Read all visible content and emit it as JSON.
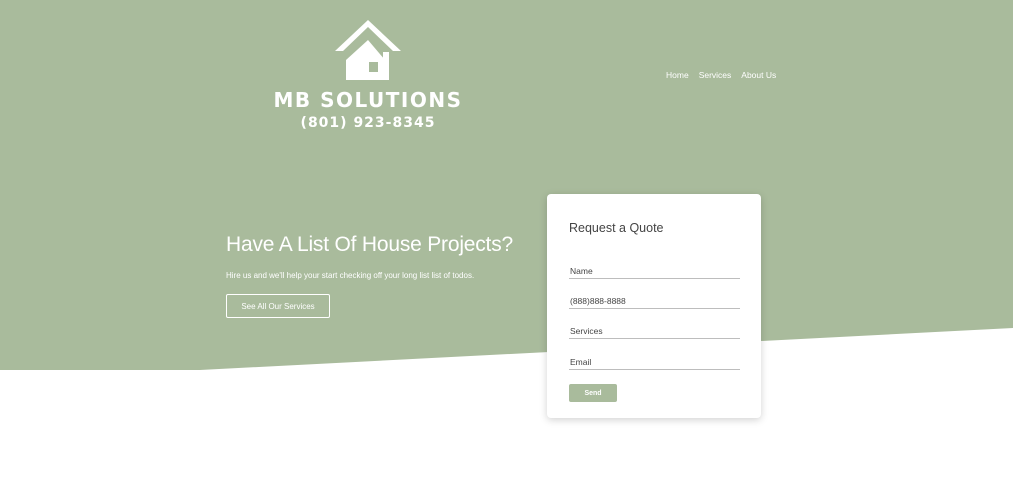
{
  "colors": {
    "brand_green": "#a9bb9c",
    "white": "#ffffff",
    "text_dark": "#444444"
  },
  "logo": {
    "icon": "house-icon",
    "brand": "MB SOLUTIONS",
    "phone": "(801) 923-8345"
  },
  "nav": {
    "items": [
      "Home",
      "Services",
      "About Us"
    ]
  },
  "hero": {
    "headline": "Have A List Of House Projects?",
    "subtext": "Hire us and we'll help your start checking off your long list list of todos.",
    "cta_label": "See All Our Services"
  },
  "quote_form": {
    "title": "Request a Quote",
    "fields": [
      {
        "placeholder": "Name"
      },
      {
        "placeholder": "(888)888-8888"
      },
      {
        "placeholder": "Services"
      },
      {
        "placeholder": "Email"
      }
    ],
    "submit_label": "Send"
  }
}
